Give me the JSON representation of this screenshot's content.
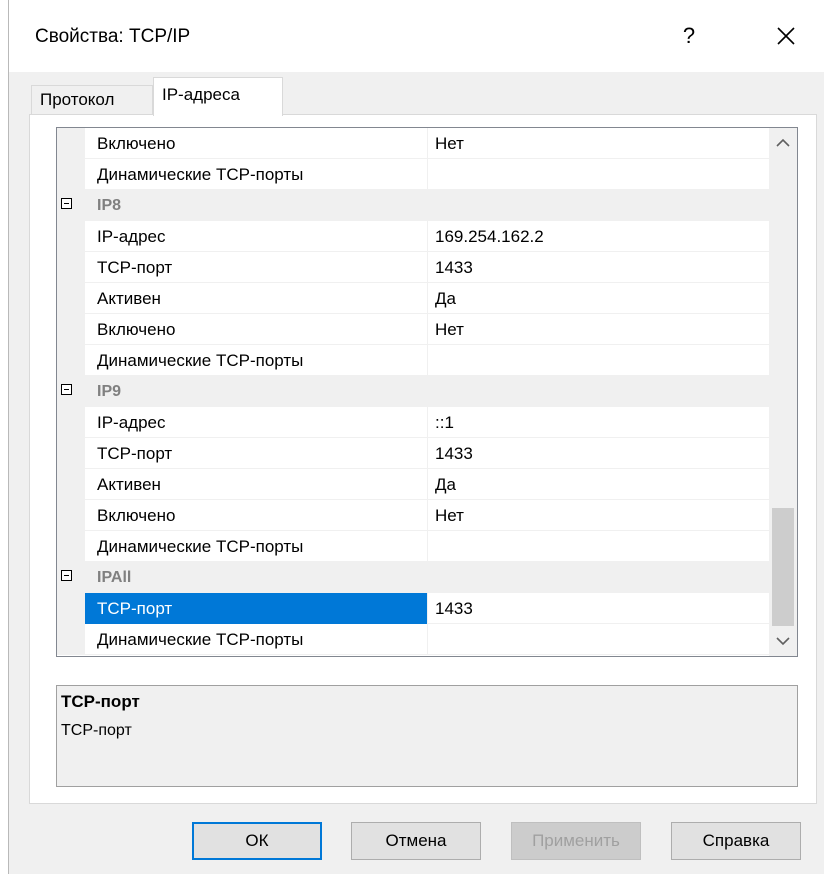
{
  "window": {
    "title": "Свойства: TCP/IP",
    "help_label": "?"
  },
  "tabs": [
    {
      "label": "Протокол",
      "active": false
    },
    {
      "label": "IP-адреса",
      "active": true
    }
  ],
  "grid": {
    "rows": [
      {
        "type": "prop",
        "name": "Включено",
        "value": "Нет"
      },
      {
        "type": "prop",
        "name": "Динамические TCP-порты",
        "value": ""
      },
      {
        "type": "category",
        "name": "IP8"
      },
      {
        "type": "prop",
        "name": "IP-адрес",
        "value": "169.254.162.2"
      },
      {
        "type": "prop",
        "name": "TCP-порт",
        "value": "1433"
      },
      {
        "type": "prop",
        "name": "Активен",
        "value": "Да"
      },
      {
        "type": "prop",
        "name": "Включено",
        "value": "Нет"
      },
      {
        "type": "prop",
        "name": "Динамические TCP-порты",
        "value": ""
      },
      {
        "type": "category",
        "name": "IP9"
      },
      {
        "type": "prop",
        "name": "IP-адрес",
        "value": "::1"
      },
      {
        "type": "prop",
        "name": "TCP-порт",
        "value": "1433"
      },
      {
        "type": "prop",
        "name": "Активен",
        "value": "Да"
      },
      {
        "type": "prop",
        "name": "Включено",
        "value": "Нет"
      },
      {
        "type": "prop",
        "name": "Динамические TCP-порты",
        "value": ""
      },
      {
        "type": "category",
        "name": "IPAll"
      },
      {
        "type": "prop",
        "name": "TCP-порт",
        "value": "1433",
        "selected": true
      },
      {
        "type": "prop",
        "name": "Динамические TCP-порты",
        "value": ""
      }
    ]
  },
  "description": {
    "title": "TCP-порт",
    "text": "TCP-порт"
  },
  "buttons": {
    "ok": "ОК",
    "cancel": "Отмена",
    "apply": "Применить",
    "help": "Справка"
  },
  "colors": {
    "selection": "#0078d7",
    "category_text": "#808080"
  },
  "icons": {
    "close": "close-icon",
    "scroll_up": "chevron-up-icon",
    "scroll_down": "chevron-down-icon",
    "collapse": "minus-box-icon"
  }
}
